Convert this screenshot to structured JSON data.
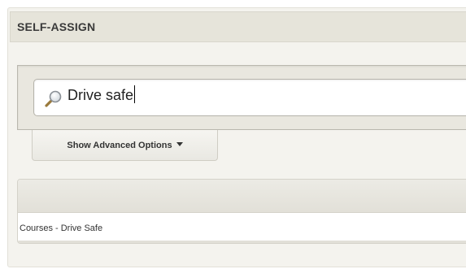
{
  "panel": {
    "title": "SELF-ASSIGN"
  },
  "search": {
    "icon": "search-icon",
    "value": "Drive safe"
  },
  "advanced": {
    "label": "Show Advanced Options"
  },
  "results": {
    "items": [
      {
        "label": "Courses - Drive Safe"
      }
    ]
  },
  "colors": {
    "panel_bg": "#f4f3ee",
    "header_bg": "#e6e4da",
    "search_bar_bg": "#e9e7df"
  }
}
